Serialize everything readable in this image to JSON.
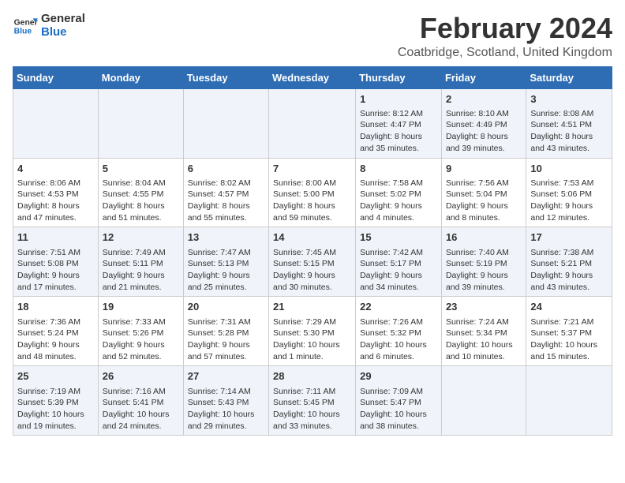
{
  "logo": {
    "line1": "General",
    "line2": "Blue"
  },
  "title": "February 2024",
  "location": "Coatbridge, Scotland, United Kingdom",
  "days_of_week": [
    "Sunday",
    "Monday",
    "Tuesday",
    "Wednesday",
    "Thursday",
    "Friday",
    "Saturday"
  ],
  "weeks": [
    [
      {
        "day": "",
        "info": ""
      },
      {
        "day": "",
        "info": ""
      },
      {
        "day": "",
        "info": ""
      },
      {
        "day": "",
        "info": ""
      },
      {
        "day": "1",
        "info": "Sunrise: 8:12 AM\nSunset: 4:47 PM\nDaylight: 8 hours and 35 minutes."
      },
      {
        "day": "2",
        "info": "Sunrise: 8:10 AM\nSunset: 4:49 PM\nDaylight: 8 hours and 39 minutes."
      },
      {
        "day": "3",
        "info": "Sunrise: 8:08 AM\nSunset: 4:51 PM\nDaylight: 8 hours and 43 minutes."
      }
    ],
    [
      {
        "day": "4",
        "info": "Sunrise: 8:06 AM\nSunset: 4:53 PM\nDaylight: 8 hours and 47 minutes."
      },
      {
        "day": "5",
        "info": "Sunrise: 8:04 AM\nSunset: 4:55 PM\nDaylight: 8 hours and 51 minutes."
      },
      {
        "day": "6",
        "info": "Sunrise: 8:02 AM\nSunset: 4:57 PM\nDaylight: 8 hours and 55 minutes."
      },
      {
        "day": "7",
        "info": "Sunrise: 8:00 AM\nSunset: 5:00 PM\nDaylight: 8 hours and 59 minutes."
      },
      {
        "day": "8",
        "info": "Sunrise: 7:58 AM\nSunset: 5:02 PM\nDaylight: 9 hours and 4 minutes."
      },
      {
        "day": "9",
        "info": "Sunrise: 7:56 AM\nSunset: 5:04 PM\nDaylight: 9 hours and 8 minutes."
      },
      {
        "day": "10",
        "info": "Sunrise: 7:53 AM\nSunset: 5:06 PM\nDaylight: 9 hours and 12 minutes."
      }
    ],
    [
      {
        "day": "11",
        "info": "Sunrise: 7:51 AM\nSunset: 5:08 PM\nDaylight: 9 hours and 17 minutes."
      },
      {
        "day": "12",
        "info": "Sunrise: 7:49 AM\nSunset: 5:11 PM\nDaylight: 9 hours and 21 minutes."
      },
      {
        "day": "13",
        "info": "Sunrise: 7:47 AM\nSunset: 5:13 PM\nDaylight: 9 hours and 25 minutes."
      },
      {
        "day": "14",
        "info": "Sunrise: 7:45 AM\nSunset: 5:15 PM\nDaylight: 9 hours and 30 minutes."
      },
      {
        "day": "15",
        "info": "Sunrise: 7:42 AM\nSunset: 5:17 PM\nDaylight: 9 hours and 34 minutes."
      },
      {
        "day": "16",
        "info": "Sunrise: 7:40 AM\nSunset: 5:19 PM\nDaylight: 9 hours and 39 minutes."
      },
      {
        "day": "17",
        "info": "Sunrise: 7:38 AM\nSunset: 5:21 PM\nDaylight: 9 hours and 43 minutes."
      }
    ],
    [
      {
        "day": "18",
        "info": "Sunrise: 7:36 AM\nSunset: 5:24 PM\nDaylight: 9 hours and 48 minutes."
      },
      {
        "day": "19",
        "info": "Sunrise: 7:33 AM\nSunset: 5:26 PM\nDaylight: 9 hours and 52 minutes."
      },
      {
        "day": "20",
        "info": "Sunrise: 7:31 AM\nSunset: 5:28 PM\nDaylight: 9 hours and 57 minutes."
      },
      {
        "day": "21",
        "info": "Sunrise: 7:29 AM\nSunset: 5:30 PM\nDaylight: 10 hours and 1 minute."
      },
      {
        "day": "22",
        "info": "Sunrise: 7:26 AM\nSunset: 5:32 PM\nDaylight: 10 hours and 6 minutes."
      },
      {
        "day": "23",
        "info": "Sunrise: 7:24 AM\nSunset: 5:34 PM\nDaylight: 10 hours and 10 minutes."
      },
      {
        "day": "24",
        "info": "Sunrise: 7:21 AM\nSunset: 5:37 PM\nDaylight: 10 hours and 15 minutes."
      }
    ],
    [
      {
        "day": "25",
        "info": "Sunrise: 7:19 AM\nSunset: 5:39 PM\nDaylight: 10 hours and 19 minutes."
      },
      {
        "day": "26",
        "info": "Sunrise: 7:16 AM\nSunset: 5:41 PM\nDaylight: 10 hours and 24 minutes."
      },
      {
        "day": "27",
        "info": "Sunrise: 7:14 AM\nSunset: 5:43 PM\nDaylight: 10 hours and 29 minutes."
      },
      {
        "day": "28",
        "info": "Sunrise: 7:11 AM\nSunset: 5:45 PM\nDaylight: 10 hours and 33 minutes."
      },
      {
        "day": "29",
        "info": "Sunrise: 7:09 AM\nSunset: 5:47 PM\nDaylight: 10 hours and 38 minutes."
      },
      {
        "day": "",
        "info": ""
      },
      {
        "day": "",
        "info": ""
      }
    ]
  ]
}
